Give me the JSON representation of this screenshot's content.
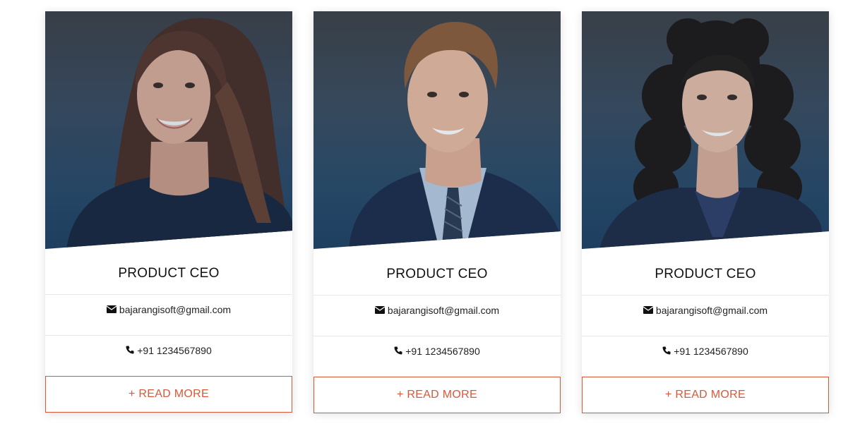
{
  "team": {
    "members": [
      {
        "role": "PRODUCT CEO",
        "email": "bajarangisoft@gmail.com",
        "phone": "+91 1234567890",
        "button": "+ READ MORE"
      },
      {
        "role": "PRODUCT CEO",
        "email": "bajarangisoft@gmail.com",
        "phone": "+91 1234567890",
        "button": "+ READ MORE"
      },
      {
        "role": "PRODUCT CEO",
        "email": "bajarangisoft@gmail.com",
        "phone": "+91 1234567890",
        "button": "+ READ MORE"
      }
    ]
  },
  "colors": {
    "accent": "#d9583a",
    "photo_overlay": "#1f3f60",
    "text": "#111111",
    "divider": "#e8e8e8"
  },
  "icons": [
    "envelope-icon",
    "phone-icon"
  ]
}
